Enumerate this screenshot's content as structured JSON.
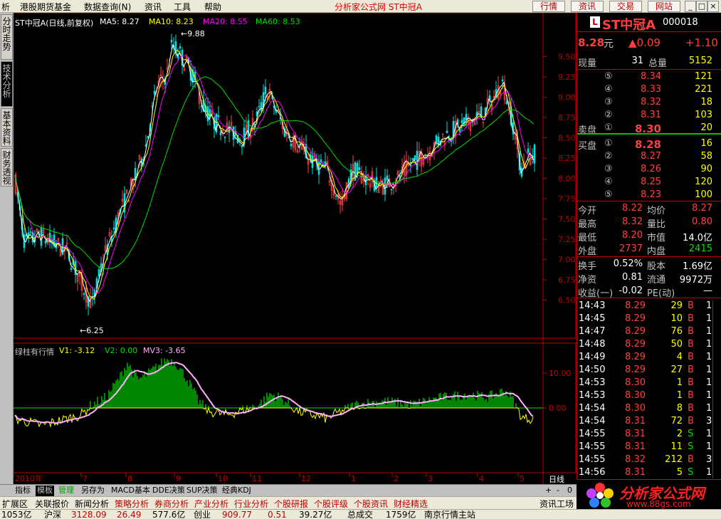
{
  "menu": {
    "items": [
      "析",
      "港股期货基金",
      "数据查询(N)",
      "资讯",
      "工具",
      "帮助"
    ],
    "title": "分析家公式网 ST中冠A",
    "right_buttons": [
      "行情",
      "资讯",
      "交易",
      "网站"
    ],
    "window_controls": [
      "_",
      "□",
      "×"
    ]
  },
  "left_tabs": [
    "分时走势",
    "技术分析",
    "基本资料",
    "财务透视"
  ],
  "main_legend": {
    "name": "ST中冠A(日线,前复权)",
    "ma5": "MA5: 8.27",
    "ma10": "MA10: 8.23",
    "ma20": "MA20: 8.55",
    "ma60": "MA60: 8.53"
  },
  "price_axis": [
    "9.50",
    "9.25",
    "9.00",
    "8.75",
    "8.50",
    "8.25",
    "8.00",
    "7.75",
    "7.50",
    "7.25",
    "7.00",
    "6.75",
    "6.50"
  ],
  "annotations": {
    "high": "9.88",
    "low": "6.25"
  },
  "sub_legend": {
    "name": "绿柱有行情",
    "v1": "V1: -3.12",
    "v2": "V2: 0.00",
    "mv3": "MV3: -3.65"
  },
  "sub_axis": [
    "10.00",
    "0.00"
  ],
  "date_axis": [
    "2010年",
    "7",
    "8",
    "9",
    "10",
    "11",
    "12",
    "1",
    "2",
    "3",
    "4",
    "5"
  ],
  "period_label": "日线",
  "zoom_controls": [
    "+",
    "-",
    "0"
  ],
  "colors": {
    "ma5": "#ffffff",
    "ma10": "#ffff00",
    "ma20": "#ff00ff",
    "ma60": "#00e000",
    "up": "#ff4040",
    "down": "#00e0e0",
    "bars": "#00e000",
    "v1": "#ffff00",
    "mv3": "#ffb0ff"
  },
  "quote": {
    "badge": "L",
    "name": "ST中冠A",
    "code": "000018",
    "price": "8.28",
    "price_unit": "元",
    "change": "▲0.09",
    "change2": "+1.10",
    "vol_now_label": "现量",
    "vol_now": "31",
    "vol_total_label": "总量",
    "vol_total": "5152",
    "sell_label": "卖盘",
    "sells": [
      {
        "n": "⑤",
        "p": "8.34",
        "v": "121"
      },
      {
        "n": "④",
        "p": "8.33",
        "v": "221"
      },
      {
        "n": "③",
        "p": "8.32",
        "v": "18"
      },
      {
        "n": "②",
        "p": "8.31",
        "v": "103"
      },
      {
        "n": "①",
        "p": "8.30",
        "v": "20"
      }
    ],
    "buy_label": "买盘",
    "buys": [
      {
        "n": "①",
        "p": "8.28",
        "v": "16"
      },
      {
        "n": "②",
        "p": "8.27",
        "v": "58"
      },
      {
        "n": "③",
        "p": "8.26",
        "v": "90"
      },
      {
        "n": "④",
        "p": "8.25",
        "v": "120"
      },
      {
        "n": "⑤",
        "p": "8.23",
        "v": "100"
      }
    ],
    "stats": [
      {
        "l1": "今开",
        "v1": "8.22",
        "l2": "均价",
        "v2": "8.27"
      },
      {
        "l1": "最高",
        "v1": "8.32",
        "l2": "量比",
        "v2": "0.80"
      },
      {
        "l1": "最低",
        "v1": "8.20",
        "l2": "市值",
        "v2": "14.0亿"
      },
      {
        "l1": "外盘",
        "v1": "2737",
        "l2": "内盘",
        "v2": "2415"
      }
    ],
    "stats2": [
      {
        "l1": "换手",
        "v1": "0.52%",
        "l2": "股本",
        "v2": "1.69亿"
      },
      {
        "l1": "净资",
        "v1": "0.81",
        "l2": "流通",
        "v2": "9972万"
      },
      {
        "l1": "收益(一)",
        "v1": "-0.02",
        "l2": "PE(动)",
        "v2": "—"
      }
    ]
  },
  "ticks": [
    {
      "t": "14:43",
      "p": "8.29",
      "v": "29",
      "bs": "B",
      "x": "1"
    },
    {
      "t": "14:45",
      "p": "8.29",
      "v": "10",
      "bs": "B",
      "x": "1"
    },
    {
      "t": "14:47",
      "p": "8.29",
      "v": "76",
      "bs": "B",
      "x": "1"
    },
    {
      "t": "14:48",
      "p": "8.29",
      "v": "50",
      "bs": "B",
      "x": "1"
    },
    {
      "t": "14:49",
      "p": "8.29",
      "v": "4",
      "bs": "B",
      "x": "1"
    },
    {
      "t": "14:50",
      "p": "8.29",
      "v": "27",
      "bs": "B",
      "x": "1"
    },
    {
      "t": "14:53",
      "p": "8.30",
      "v": "1",
      "bs": "B",
      "x": "1"
    },
    {
      "t": "14:53",
      "p": "8.30",
      "v": "1",
      "bs": "B",
      "x": "1"
    },
    {
      "t": "14:54",
      "p": "8.30",
      "v": "8",
      "bs": "B",
      "x": "1"
    },
    {
      "t": "14:54",
      "p": "8.31",
      "v": "72",
      "bs": "B",
      "x": "3"
    },
    {
      "t": "14:55",
      "p": "8.31",
      "v": "2",
      "bs": "S",
      "x": "1"
    },
    {
      "t": "14:55",
      "p": "8.31",
      "v": "11",
      "bs": "S",
      "x": "1"
    },
    {
      "t": "14:55",
      "p": "8.32",
      "v": "212",
      "bs": "B",
      "x": "3"
    },
    {
      "t": "14:56",
      "p": "8.31",
      "v": "5",
      "bs": "S",
      "x": "1"
    }
  ],
  "bottom_tabs": [
    "指标",
    "模板",
    "管理",
    "另存为",
    "MACD基本",
    "DDE决策",
    "SUP决策",
    "经典KDJ"
  ],
  "bar2": [
    "扩展区",
    "关联报价",
    "新闻分析",
    "策略分析",
    "券商分析",
    "产业分析",
    "行业分析",
    "个股研报",
    "个股评级",
    "个股资讯",
    "财经精选"
  ],
  "bar2_right": "资讯工场",
  "status": [
    "1053亿",
    "沪深",
    "3128.09",
    "26.49",
    "577.6亿",
    "创业",
    "909.77",
    "0.51",
    "39.27亿",
    "总成交",
    "1759亿",
    "南京行情主站"
  ],
  "logo": {
    "text": "分析家公式网",
    "url": "www.88gs.com"
  }
}
